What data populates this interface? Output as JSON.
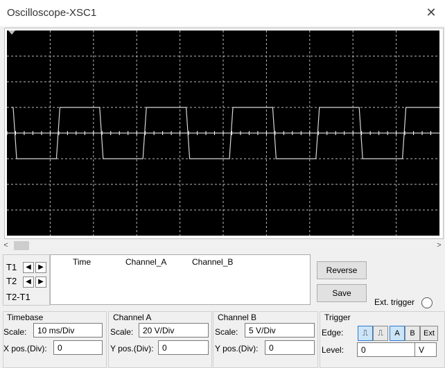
{
  "window": {
    "title": "Oscilloscope-XSC1",
    "close_glyph": "✕"
  },
  "scrollbar": {
    "left_arrow": "<",
    "right_arrow": ">"
  },
  "cursors": {
    "t1_label": "T1",
    "t2_label": "T2",
    "diff_label": "T2-T1"
  },
  "readout": {
    "headers": [
      "Time",
      "Channel_A",
      "Channel_B"
    ]
  },
  "buttons": {
    "reverse": "Reverse",
    "save": "Save"
  },
  "ext_trigger_label": "Ext. trigger",
  "timebase": {
    "title": "Timebase",
    "scale_label": "Scale:",
    "scale_value": "10 ms/Div",
    "xpos_label": "X pos.(Div):",
    "xpos_value": "0"
  },
  "channel_a": {
    "title": "Channel A",
    "scale_label": "Scale:",
    "scale_value": "20  V/Div",
    "ypos_label": "Y pos.(Div):",
    "ypos_value": "0"
  },
  "channel_b": {
    "title": "Channel B",
    "scale_label": "Scale:",
    "scale_value": "5  V/Div",
    "ypos_label": "Y pos.(Div):",
    "ypos_value": "0"
  },
  "trigger": {
    "title": "Trigger",
    "edge_label": "Edge:",
    "level_label": "Level:",
    "level_value": "0",
    "level_unit": "V",
    "btn_a": "A",
    "btn_b": "B",
    "btn_ext": "Ext"
  },
  "waveform": {
    "color": "#d8d8d8",
    "grid_color": "#bbbbbb",
    "volts_per_div": 20,
    "ms_per_div": 10,
    "high_v": 20,
    "low_v": -20,
    "period_ms": 20
  }
}
